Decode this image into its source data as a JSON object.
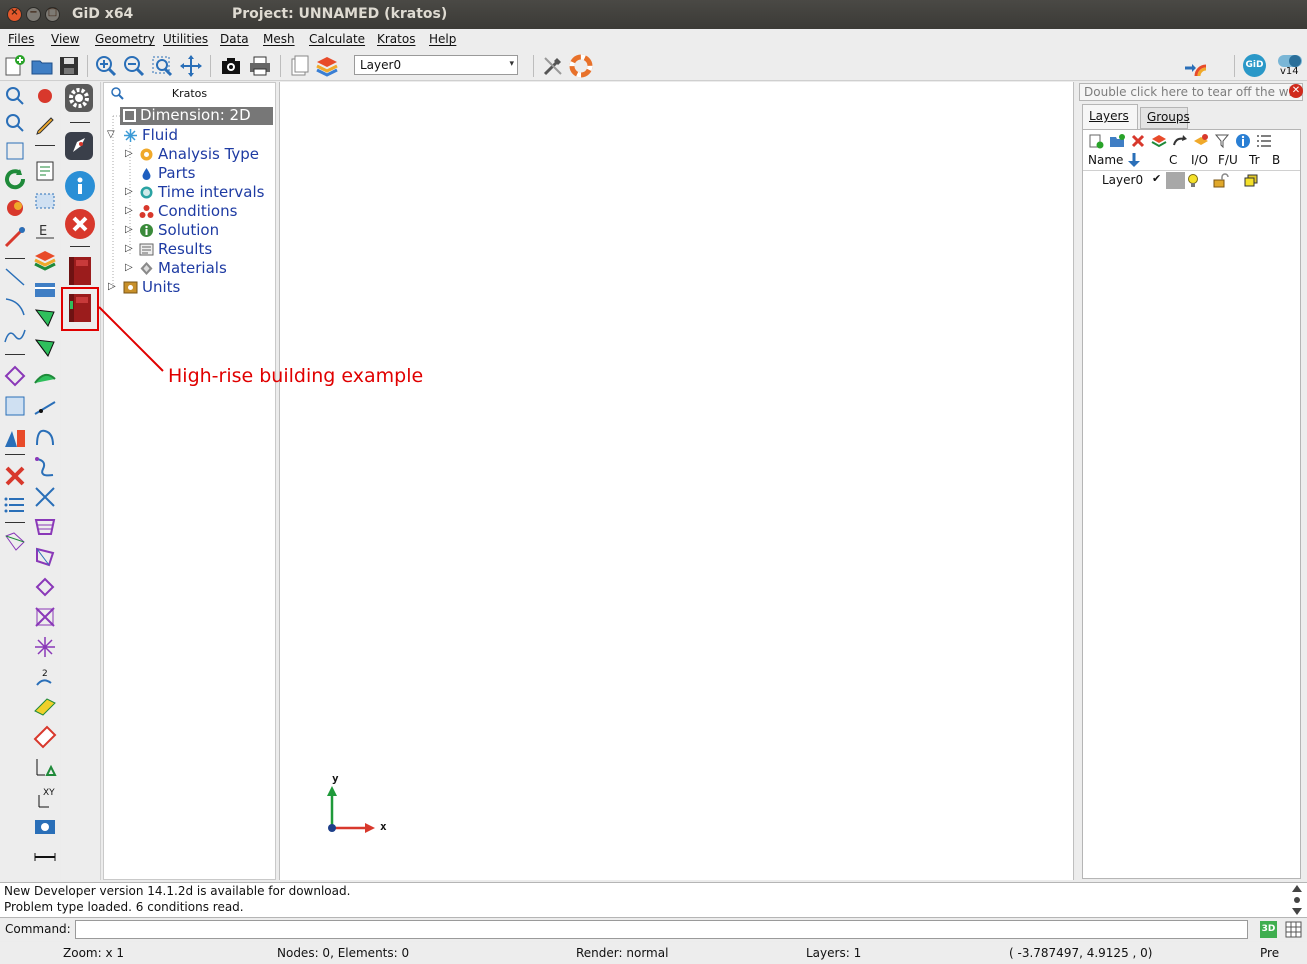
{
  "window": {
    "app_title": "GiD x64",
    "project_title": "Project: UNNAMED (kratos)",
    "close_symbol": "×",
    "min_symbol": "−",
    "max_symbol": "□"
  },
  "menu": [
    "Files",
    "View",
    "Geometry",
    "Utilities",
    "Data",
    "Mesh",
    "Calculate",
    "Kratos",
    "Help"
  ],
  "toolbar": {
    "layer_value": "Layer0",
    "version_badge": "v14",
    "gid_logo": "GiD"
  },
  "tree": {
    "header": "Kratos",
    "dimension": "Dimension: 2D",
    "fluid": "Fluid",
    "items": [
      "Analysis Type",
      "Parts",
      "Time intervals",
      "Conditions",
      "Solution",
      "Results",
      "Materials"
    ],
    "units": "Units"
  },
  "annotation": {
    "text": "High-rise building example",
    "color": "#e00000"
  },
  "axes": {
    "y_label": "y",
    "x_label": "x"
  },
  "right_panel": {
    "tearoff_hint": "Double click here to tear off the window",
    "tabs": [
      "Layers",
      "Groups"
    ],
    "columns": [
      "Name",
      "C",
      "I/O",
      "F/U",
      "Tr",
      "B"
    ],
    "layer_row": {
      "name": "Layer0",
      "check": "✔",
      "color": "#a8a8a8"
    }
  },
  "messages": [
    "New Developer version 14.1.2d is available for download.",
    "Problem type loaded. 6 conditions read."
  ],
  "command": {
    "label": "Command:",
    "value": "",
    "btn_3d": "3D"
  },
  "status": {
    "zoom": "Zoom: x 1",
    "counts": "Nodes: 0, Elements: 0",
    "render": "Render: normal",
    "layers": "Layers: 1",
    "coords": "( -3.787497,  4.9125 ,  0)",
    "mode": "Pre"
  },
  "colors": {
    "titlebar": "#3b3a36",
    "tree_text": "#1e3ba3",
    "kratos_icon_gray": "#5a5a5a",
    "kratos_icon_blue": "#2a8fd6",
    "kratos_icon_red": "#d8382c",
    "book_red": "#9b1c1c"
  }
}
